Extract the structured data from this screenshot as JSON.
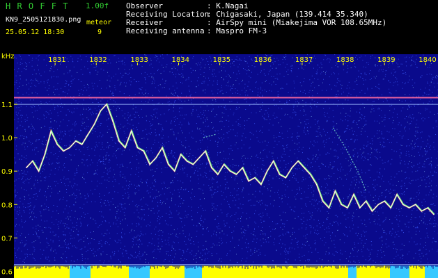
{
  "header": {
    "app_name": "H R O F F T",
    "version": "1.00f",
    "filename": "KN9_2505121830.png",
    "datetime": "25.05.12 18:30",
    "meteor_label": "meteor",
    "meteor_count": "9",
    "fields": [
      {
        "label": "Observer",
        "value": ": K.Nagai"
      },
      {
        "label": "Receiving Location",
        "value": ": Chigasaki, Japan (139.414 35.340)"
      },
      {
        "label": "Receiver",
        "value": ": AirSpy mini (Miakejima VOR 108.65MHz)"
      },
      {
        "label": "Receiving antenna",
        "value": ": Maspro FM-3"
      }
    ]
  },
  "chart_data": {
    "type": "spectrogram",
    "y_unit": "kHz",
    "ylim": [
      0.58,
      1.25
    ],
    "y_ticks": [
      "1.1",
      "1.0",
      "0.9",
      "0.8",
      "0.7",
      "0.6"
    ],
    "x_ticks": [
      "1831",
      "1832",
      "1833",
      "1834",
      "1835",
      "1836",
      "1837",
      "1838",
      "1839",
      "1840"
    ],
    "trace": {
      "name": "",
      "x": [
        1830.3,
        1830.45,
        1830.6,
        1830.75,
        1830.9,
        1831.05,
        1831.2,
        1831.35,
        1831.5,
        1831.65,
        1831.8,
        1831.95,
        1832.1,
        1832.25,
        1832.4,
        1832.55,
        1832.7,
        1832.85,
        1833.0,
        1833.15,
        1833.3,
        1833.45,
        1833.6,
        1833.75,
        1833.9,
        1834.05,
        1834.2,
        1834.35,
        1834.5,
        1834.65,
        1834.8,
        1834.95,
        1835.1,
        1835.25,
        1835.4,
        1835.55,
        1835.7,
        1835.85,
        1836.0,
        1836.15,
        1836.3,
        1836.45,
        1836.6,
        1836.75,
        1836.9,
        1837.05,
        1837.2,
        1837.35,
        1837.5,
        1837.65,
        1837.8,
        1837.95,
        1838.1,
        1838.25,
        1838.4,
        1838.55,
        1838.7,
        1838.85,
        1839.0,
        1839.15,
        1839.3,
        1839.45,
        1839.6,
        1839.75,
        1839.9,
        1840.05,
        1840.2
      ],
      "y": [
        0.91,
        0.93,
        0.9,
        0.95,
        1.02,
        0.98,
        0.96,
        0.97,
        0.99,
        0.98,
        1.01,
        1.04,
        1.08,
        1.1,
        1.05,
        0.99,
        0.97,
        1.02,
        0.97,
        0.96,
        0.92,
        0.94,
        0.97,
        0.92,
        0.9,
        0.95,
        0.93,
        0.92,
        0.94,
        0.96,
        0.91,
        0.89,
        0.92,
        0.9,
        0.89,
        0.91,
        0.87,
        0.88,
        0.86,
        0.9,
        0.93,
        0.89,
        0.88,
        0.91,
        0.93,
        0.91,
        0.89,
        0.86,
        0.81,
        0.79,
        0.84,
        0.8,
        0.79,
        0.83,
        0.79,
        0.81,
        0.78,
        0.8,
        0.81,
        0.79,
        0.83,
        0.8,
        0.79,
        0.8,
        0.78,
        0.79,
        0.77
      ]
    },
    "faint_traces": [
      {
        "x": [
          1834.6,
          1834.9
        ],
        "y": [
          1.0,
          1.01
        ]
      },
      {
        "x": [
          1837.75,
          1838.05,
          1838.35,
          1838.55
        ],
        "y": [
          1.03,
          0.97,
          0.9,
          0.84
        ]
      }
    ],
    "carrier_lines": [
      1.12,
      1.1,
      0.62,
      0.61
    ],
    "colors": {
      "background": "#0a0a8c",
      "noise": "#3c5cff",
      "trace": "#ffffff",
      "carrier": "#ff6aa0",
      "baseline": "#ffff00",
      "baseline_alt": "#36c8ff",
      "ticks": "#ffff00"
    }
  }
}
